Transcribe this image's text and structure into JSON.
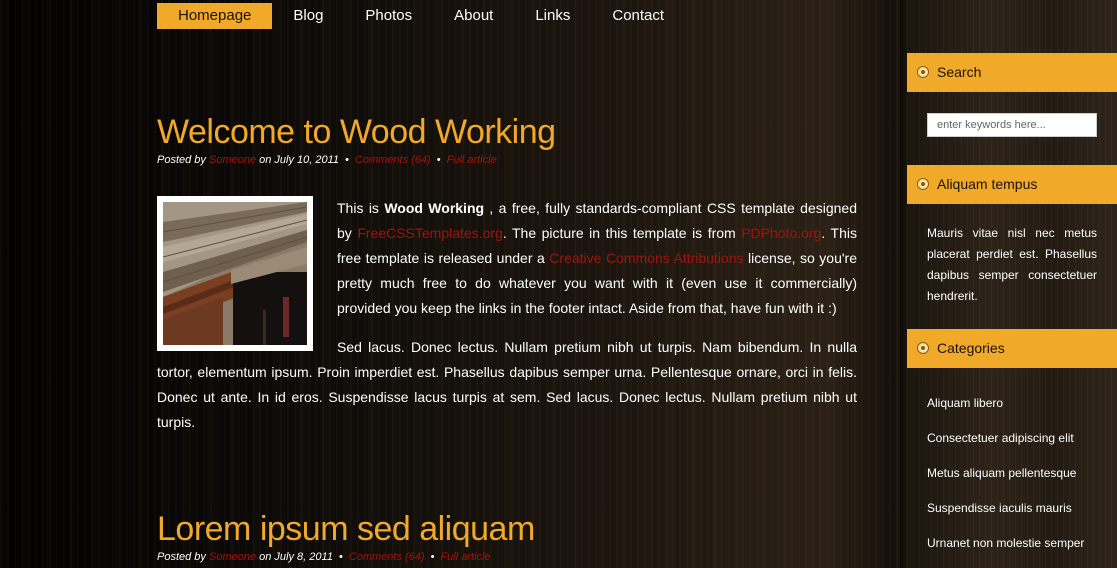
{
  "nav": {
    "items": [
      {
        "label": "Homepage",
        "active": true
      },
      {
        "label": "Blog",
        "active": false
      },
      {
        "label": "Photos",
        "active": false
      },
      {
        "label": "About",
        "active": false
      },
      {
        "label": "Links",
        "active": false
      },
      {
        "label": "Contact",
        "active": false
      }
    ]
  },
  "colors": {
    "accent": "#f0a928",
    "link": "#a0140f",
    "text": "#ffffff"
  },
  "posts": [
    {
      "title": "Welcome to Wood Working",
      "meta": {
        "posted_by": "Posted by",
        "author": "Someone",
        "date": "on July 10, 2011",
        "comments": "Comments (64)",
        "full": "Full article"
      },
      "p1": {
        "t1": "This is ",
        "name": "Wood Working",
        "t2": " , a free, fully standards-compliant CSS template designed by ",
        "link1": "FreeCSSTemplates.org",
        "t3": ". The picture in this template is from ",
        "link2": "PDPhoto.org",
        "t4": ". This free template is released under a ",
        "link3": "Creative Commons Attributions",
        "t5": " license, so you're pretty much free to do whatever you want with it (even use it commercially) provided you keep the links in the footer intact. Aside from that, have fun with it :)"
      },
      "p2": "Sed lacus. Donec lectus. Nullam pretium nibh ut turpis. Nam bibendum. In nulla tortor, elementum ipsum. Proin imperdiet est. Phasellus dapibus semper urna. Pellentesque ornare, orci in felis. Donec ut ante. In id eros. Suspendisse lacus turpis at sem. Sed lacus. Donec lectus. Nullam pretium nibh ut turpis."
    },
    {
      "title": "Lorem ipsum sed aliquam",
      "meta": {
        "posted_by": "Posted by",
        "author": "Someone",
        "date": "on July 8, 2011",
        "comments": "Comments (64)",
        "full": "Full article"
      }
    }
  ],
  "sidebar": {
    "search": {
      "title": "Search",
      "placeholder": "enter keywords here..."
    },
    "aliquam": {
      "title": "Aliquam tempus",
      "text": "Mauris vitae nisl nec metus placerat perdiet est. Phasellus dapibus semper consectetuer hendrerit."
    },
    "categories": {
      "title": "Categories",
      "items": [
        "Aliquam libero",
        "Consectetuer adipiscing elit",
        "Metus aliquam pellentesque",
        "Suspendisse iaculis mauris",
        "Urnanet non molestie semper"
      ]
    }
  }
}
